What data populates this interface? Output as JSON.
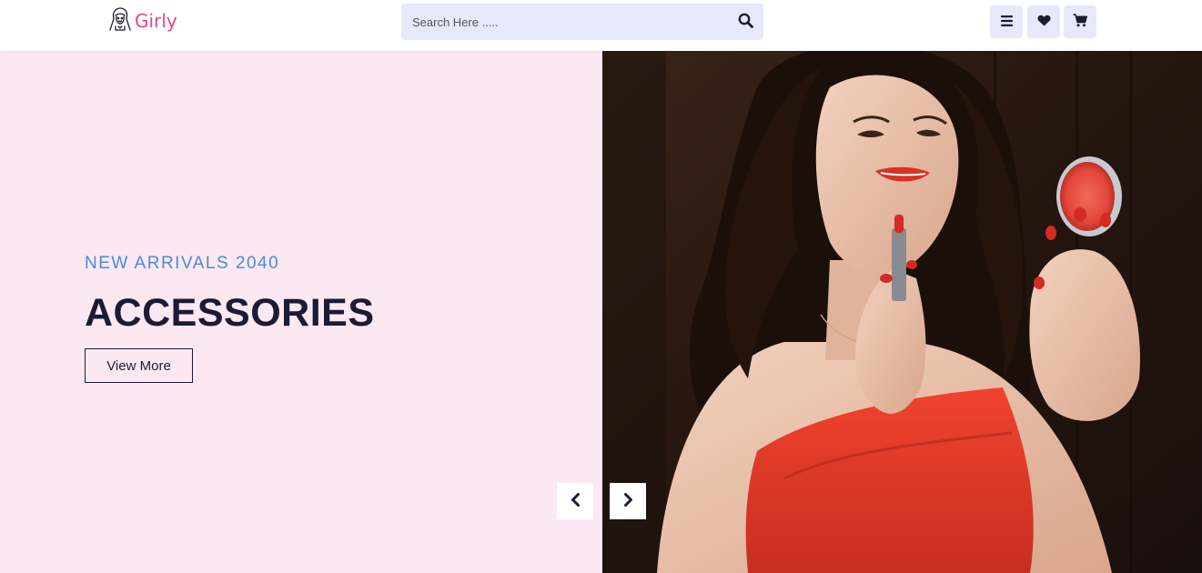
{
  "colors": {
    "brand_pink": "#e0488e",
    "hero_bg": "#fce8f2",
    "search_bg": "#e8e8fc",
    "icon_btn_bg": "#e8e8fc",
    "accent_blue": "#4a8ad8",
    "dark_navy": "#1c1b34",
    "photo_bg_dark": "#2a1a14",
    "dress_red": "#e8392b"
  },
  "header": {
    "brand": {
      "name": "Girly",
      "logo_icon": "girl-face-icon"
    },
    "search": {
      "placeholder": "Search Here .....",
      "value": "",
      "icon": "search-icon"
    },
    "actions": [
      {
        "name": "menu",
        "icon": "hamburger-icon"
      },
      {
        "name": "wishlist",
        "icon": "heart-icon"
      },
      {
        "name": "cart",
        "icon": "shopping-cart-icon"
      }
    ]
  },
  "hero": {
    "eyebrow": "NEW ARRIVALS 2040",
    "title": "ACCESSORIES",
    "cta_label": "View More",
    "prev_icon": "chevron-left-icon",
    "next_icon": "chevron-right-icon",
    "image": "woman-applying-lipstick-photo"
  }
}
